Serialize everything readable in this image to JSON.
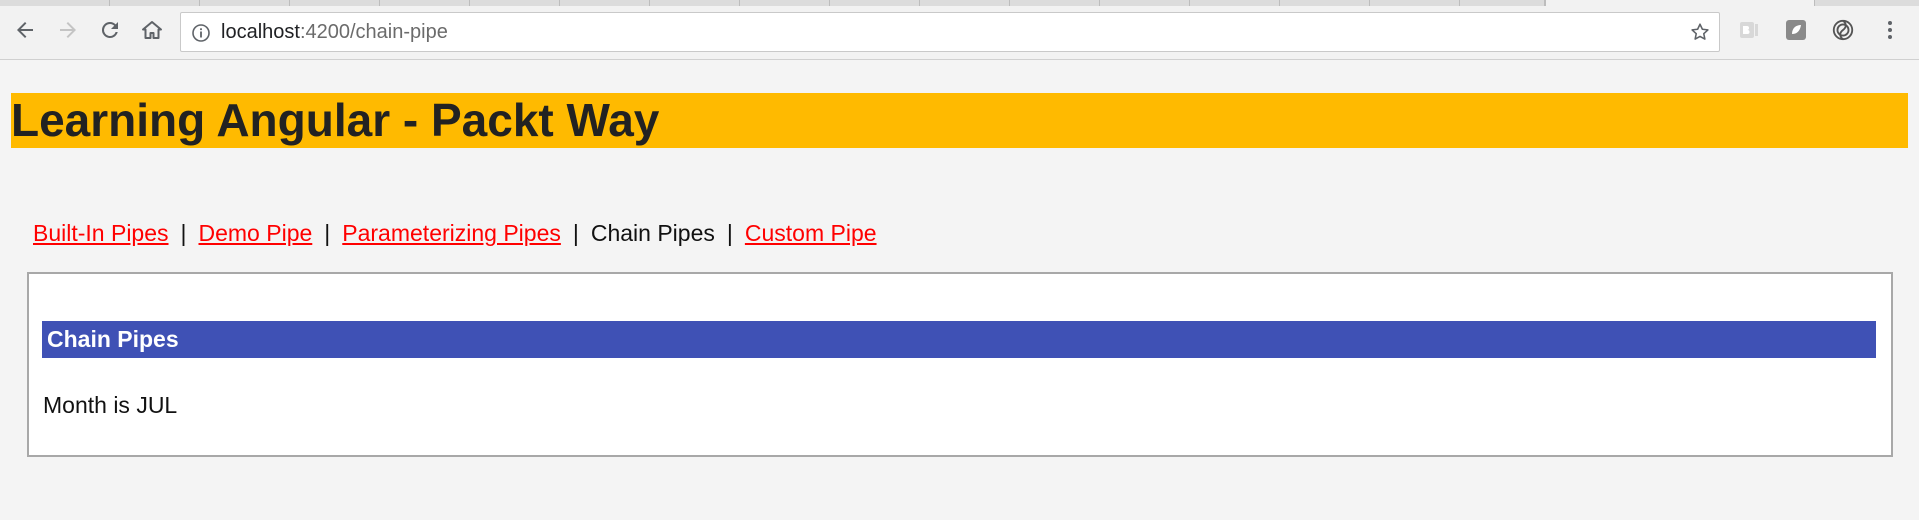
{
  "browser": {
    "url_host": "localhost",
    "url_rest": ":4200/chain-pipe",
    "back_icon": "arrow-left-icon",
    "forward_icon": "arrow-right-icon",
    "reload_icon": "reload-icon",
    "home_icon": "home-icon",
    "info_icon": "info-icon",
    "bookmark_icon": "star-icon",
    "extensions": [
      "bi-extension-icon",
      "gray-extension-icon",
      "swirl-extension-icon",
      "more-vert-icon"
    ]
  },
  "header": {
    "title": "Learning Angular - Packt Way",
    "background": "#ffba00"
  },
  "nav": {
    "links": [
      {
        "label": "Built-In Pipes",
        "active": false
      },
      {
        "label": "Demo Pipe",
        "active": false
      },
      {
        "label": "Parameterizing Pipes",
        "active": false
      },
      {
        "label": "Chain Pipes",
        "active": true
      },
      {
        "label": "Custom Pipe",
        "active": false
      }
    ],
    "separator": "|",
    "link_color": "#ff0000"
  },
  "panel": {
    "title": "Chain Pipes",
    "title_background": "#3f51b5",
    "text": "Month is JUL"
  }
}
